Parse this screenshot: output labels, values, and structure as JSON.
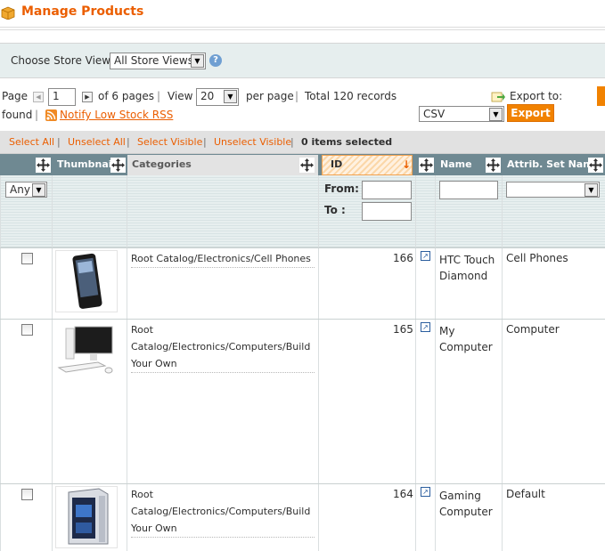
{
  "header": {
    "title": "Manage Products"
  },
  "store_view": {
    "label": "Choose Store View:",
    "selected": "All Store Views"
  },
  "pager": {
    "page_label": "Page",
    "page_value": "1",
    "of_pages": "of 6 pages",
    "view_label": "View",
    "per_page_value": "20",
    "per_page_label": "per page",
    "total_records": "Total 120 records",
    "found": "found",
    "rss_link": "Notify Low Stock RSS"
  },
  "export": {
    "label": "Export to:",
    "format": "CSV",
    "button": "Export"
  },
  "massaction": {
    "select_all": "Select All",
    "unselect_all": "Unselect All",
    "select_visible": "Select Visible",
    "unselect_visible": "Unselect Visible",
    "selected_count": "0 items selected",
    "separator": "|"
  },
  "columns": {
    "thumbnail": "Thumbnail",
    "categories": "Categories",
    "id": "ID",
    "name": "Name",
    "attrib_set": "Attrib. Set Name"
  },
  "filters": {
    "any": "Any",
    "from": "From:",
    "to": "To :"
  },
  "rows": [
    {
      "categories": "Root Catalog/Electronics/Cell Phones",
      "id": "166",
      "name": "HTC Touch Diamond",
      "attrib_set": "Cell Phones"
    },
    {
      "categories": "Root Catalog/Electronics/Computers/Build Your Own",
      "id": "165",
      "name": "My Computer",
      "attrib_set": "Computer"
    },
    {
      "categories": "Root Catalog/Electronics/Computers/Build Your Own",
      "id": "164",
      "name": "Gaming Computer",
      "attrib_set": "Default"
    }
  ],
  "colors": {
    "accent": "#eb5e00",
    "header_bar": "#6f8992",
    "filter_bg": "#e7efef"
  }
}
